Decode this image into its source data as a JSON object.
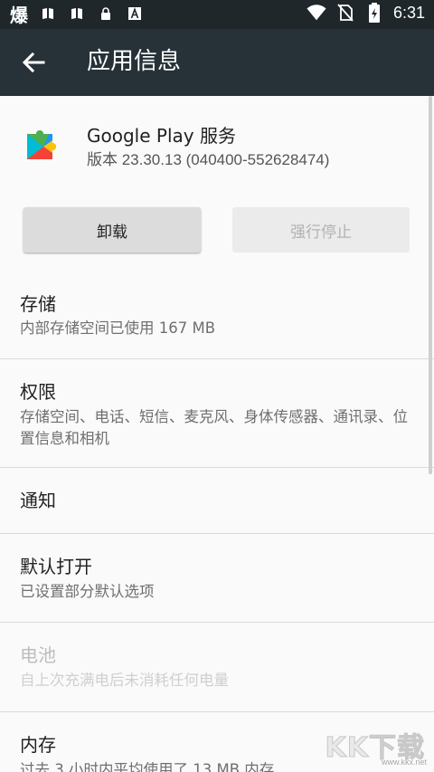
{
  "status_bar": {
    "brand": "爆",
    "time": "6:31",
    "icons": [
      "book-icon",
      "book-icon",
      "lock-icon",
      "font-a-icon",
      "wifi-icon",
      "no-sim-icon",
      "battery-icon"
    ]
  },
  "app_bar": {
    "title": "应用信息"
  },
  "app": {
    "name": "Google Play 服务",
    "version": "版本 23.30.13 (040400-552628474)"
  },
  "buttons": {
    "uninstall": "卸载",
    "force_stop": "强行停止"
  },
  "items": [
    {
      "label": "存储",
      "sub": "内部存储空间已使用 167 MB",
      "enabled": true
    },
    {
      "label": "权限",
      "sub": "存储空间、电话、短信、麦克风、身体传感器、通讯录、位置信息和相机",
      "enabled": true
    },
    {
      "label": "通知",
      "sub": "",
      "enabled": true
    },
    {
      "label": "默认打开",
      "sub": "已设置部分默认选项",
      "enabled": true
    },
    {
      "label": "电池",
      "sub": "自上次充满电后未消耗任何电量",
      "enabled": false
    },
    {
      "label": "内存",
      "sub": "过去 3 小时内平均使用了 13 MB 内存",
      "enabled": true
    }
  ],
  "watermark": {
    "text": "KK下载",
    "url": "www.kkx.net"
  },
  "colors": {
    "status_bar": "#1f272b",
    "app_bar": "#263238",
    "background": "#fafafa"
  }
}
